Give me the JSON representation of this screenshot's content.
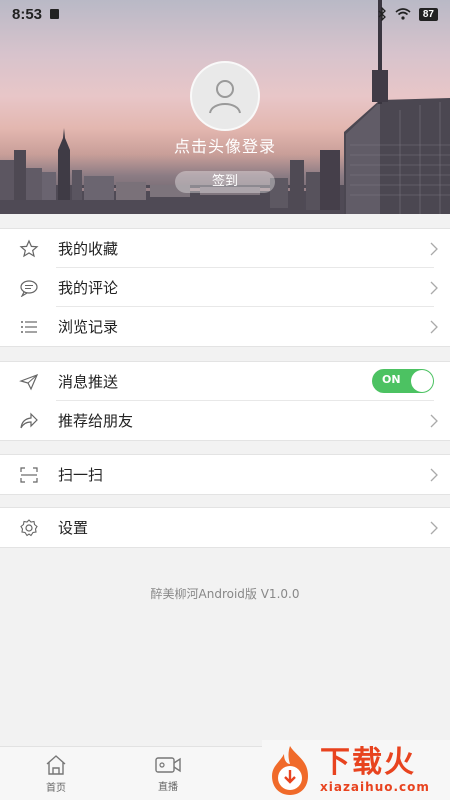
{
  "status_bar": {
    "time": "8:53",
    "battery": "87"
  },
  "profile": {
    "login_prompt": "点击头像登录",
    "signin_label": "签到"
  },
  "groups": [
    {
      "items": [
        {
          "icon": "star-icon",
          "label": "我的收藏"
        },
        {
          "icon": "comment-icon",
          "label": "我的评论"
        },
        {
          "icon": "list-icon",
          "label": "浏览记录"
        }
      ]
    },
    {
      "items": [
        {
          "icon": "send-icon",
          "label": "消息推送",
          "toggle": "ON",
          "toggle_state": true
        },
        {
          "icon": "share-icon",
          "label": "推荐给朋友"
        }
      ]
    },
    {
      "items": [
        {
          "icon": "scan-icon",
          "label": "扫一扫"
        }
      ]
    },
    {
      "items": [
        {
          "icon": "gear-icon",
          "label": "设置"
        }
      ]
    }
  ],
  "version": "醉美柳河Android版 V1.0.0",
  "bottom_nav": [
    {
      "icon": "home-icon",
      "label": "首页"
    },
    {
      "icon": "video-camera-icon",
      "label": "直播"
    }
  ],
  "watermark": {
    "title": "下载火",
    "domain": "xiazaihuo.com"
  },
  "colors": {
    "toggle_on": "#4cc262",
    "watermark": "#e8431f"
  }
}
